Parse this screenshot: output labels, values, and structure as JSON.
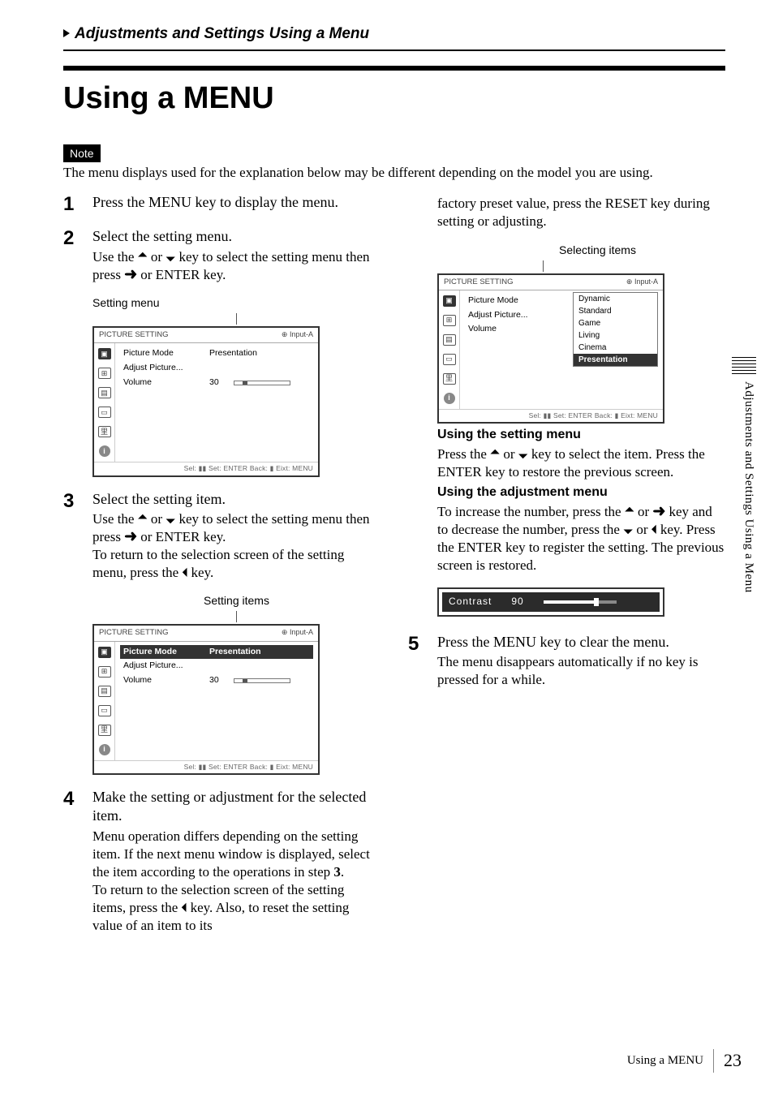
{
  "section_header": "Adjustments and Settings Using a Menu",
  "page_title": "Using a MENU",
  "note_label": "Note",
  "note_text": "The menu displays used for the explanation below may be different depending on the model you are using.",
  "steps": {
    "s1_lead": "Press the MENU key to display the menu.",
    "s2_lead": "Select the setting menu.",
    "s2_rest_a": "Use the ",
    "s2_rest_b": " or ",
    "s2_rest_c": " key to select the setting menu then press ",
    "s2_rest_d": " or ENTER key.",
    "caption_setting_menu": "Setting menu",
    "s3_lead": "Select the setting item.",
    "s3_rest_a": "Use the ",
    "s3_rest_b": " or ",
    "s3_rest_c": " key to select the setting menu then press ",
    "s3_rest_d": " or ENTER key.",
    "s3_rest_e": "To return to the selection screen of the setting menu, press the ",
    "s3_rest_f": " key.",
    "caption_setting_items": "Setting items",
    "s4_lead": "Make the setting or adjustment for the selected item.",
    "s4_rest_a": "Menu operation differs depending on the setting item. If the next menu window is displayed, select the item according to the operations in step ",
    "s4_step_ref": "3",
    "s4_rest_a2": ".",
    "s4_rest_b": "To return to the selection screen of the setting items, press the ",
    "s4_rest_c": " key. Also, to reset the setting value of an item to its",
    "s4_col2_a": "factory preset value, press the RESET key during setting or adjusting.",
    "caption_selecting_items": "Selecting items",
    "sub_using_setting": "Using the setting menu",
    "sub_using_setting_body_a": "Press the ",
    "sub_using_setting_body_b": " or ",
    "sub_using_setting_body_c": " key to select the item. Press the ENTER key to restore the previous screen.",
    "sub_using_adjust": "Using the adjustment menu",
    "sub_using_adjust_body_a": "To increase the number, press the ",
    "sub_using_adjust_body_b": " or ",
    "sub_using_adjust_body_c": " key and to decrease the number, press the ",
    "sub_using_adjust_body_d": " or ",
    "sub_using_adjust_body_e": " key. Press the ENTER key to register the setting. The previous screen is restored.",
    "contrast_label": "Contrast",
    "contrast_value": "90",
    "s5_lead": "Press the MENU key to clear the menu.",
    "s5_rest": "The menu disappears automatically if no key is pressed for a while."
  },
  "osd": {
    "title": "PICTURE SETTING",
    "input": "Input-A",
    "rows": {
      "picture_mode": "Picture Mode",
      "picture_mode_val": "Presentation",
      "adjust_picture": "Adjust Picture...",
      "volume": "Volume",
      "volume_val": "30"
    },
    "footer": "Sel: ▮▮   Set: ENTER   Back: ▮   Eixt: MENU",
    "dropdown": [
      "Dynamic",
      "Standard",
      "Game",
      "Living",
      "Cinema",
      "Presentation"
    ]
  },
  "side_tab": "Adjustments and Settings Using a Menu",
  "footer_label": "Using a MENU",
  "page_number": "23"
}
